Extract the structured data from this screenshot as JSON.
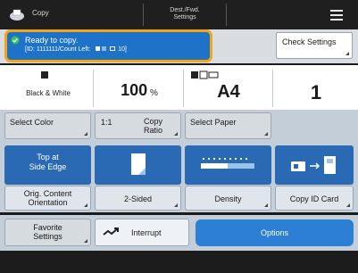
{
  "header": {
    "app_title": "Copy",
    "dest_line1": "Dest./Fwd.",
    "dest_line2": "Settings"
  },
  "status": {
    "message": "Ready to copy.",
    "details": "[ID: 1111111/Count Left:",
    "count": "10]"
  },
  "check_settings_label": "Check Settings",
  "mode": {
    "color_label": "Black & White",
    "ratio_value": "100",
    "ratio_unit": "%",
    "paper_value": "A4",
    "copies_value": "1"
  },
  "controls": {
    "select_color": "Select Color",
    "copy_ratio_prefix": "1:1",
    "copy_ratio_line1": "Copy",
    "copy_ratio_line2": "Ratio",
    "select_paper": "Select Paper"
  },
  "features": {
    "top_edge_line1": "Top at",
    "top_edge_line2": "Side Edge",
    "orig_line1": "Orig. Content",
    "orig_line2": "Orientation",
    "two_sided": "2-Sided",
    "density": "Density",
    "copy_id_card": "Copy ID Card"
  },
  "bottom": {
    "favorite_line1": "Favorite",
    "favorite_line2": "Settings",
    "interrupt": "Interrupt",
    "options": "Options"
  },
  "colors": {
    "status_blue": "#1e73c8",
    "highlight_orange": "#f2a616",
    "options_blue": "#2d7fd6"
  }
}
